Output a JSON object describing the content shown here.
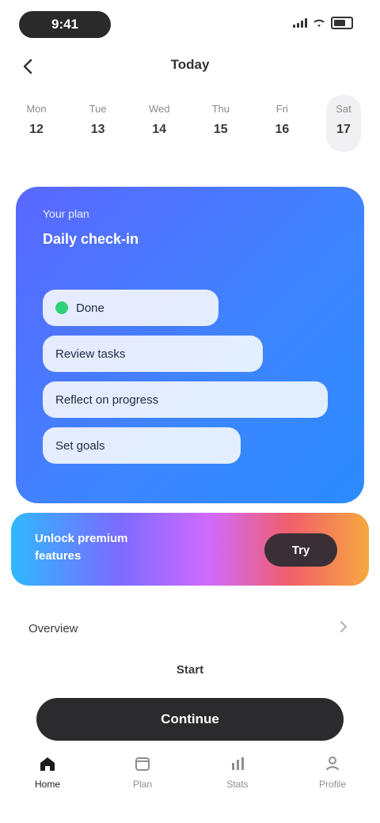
{
  "status": {
    "time": "9:41"
  },
  "header": {
    "title": "Today"
  },
  "calendar": {
    "days": [
      {
        "dow": "Mon",
        "num": "12"
      },
      {
        "dow": "Tue",
        "num": "13"
      },
      {
        "dow": "Wed",
        "num": "14"
      },
      {
        "dow": "Thu",
        "num": "15"
      },
      {
        "dow": "Fri",
        "num": "16"
      },
      {
        "dow": "Sat",
        "num": "17"
      }
    ]
  },
  "card": {
    "kicker": "Your plan",
    "title": "Daily check-in",
    "chips": [
      {
        "label": "Done"
      },
      {
        "label": "Review tasks"
      },
      {
        "label": "Reflect on progress"
      },
      {
        "label": "Set goals"
      }
    ]
  },
  "promo": {
    "line1": "Unlock premium",
    "line2": "features",
    "cta": "Try"
  },
  "section": {
    "label": "Overview"
  },
  "small_title": "Start",
  "primary_button": "Continue",
  "tabs": [
    {
      "label": "Home"
    },
    {
      "label": "Plan"
    },
    {
      "label": "Stats"
    },
    {
      "label": "Profile"
    }
  ]
}
